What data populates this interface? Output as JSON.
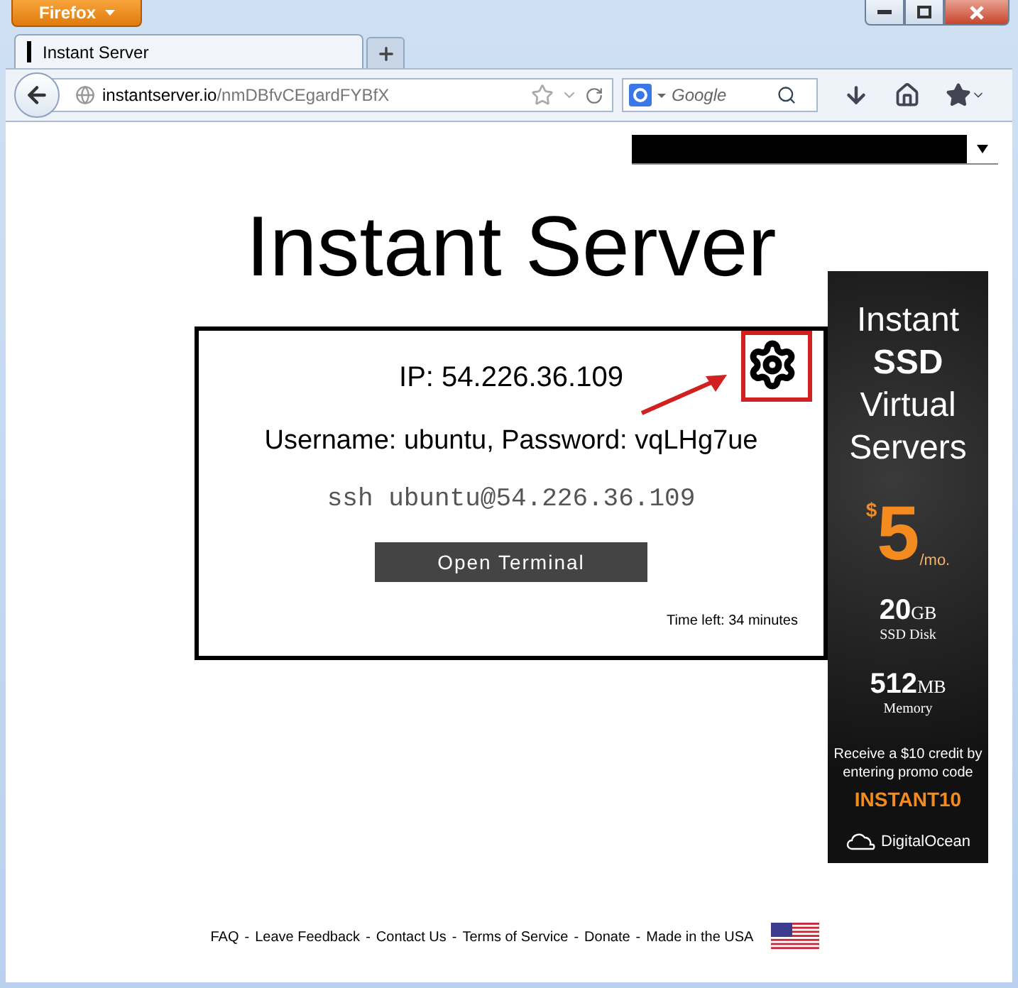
{
  "browser": {
    "app_menu": "Firefox",
    "tabs": [
      {
        "title": "Instant Server",
        "selected": true
      }
    ],
    "url": {
      "host": "instantserver.io",
      "path": "/nmDBfvCEgardFYBfX"
    },
    "search": {
      "placeholder": "Google"
    }
  },
  "page": {
    "title": "Instant Server",
    "server": {
      "ip": "IP: 54.226.36.109",
      "credentials": "Username: ubuntu, Password: vqLHg7ue",
      "ssh": "ssh ubuntu@54.226.36.109",
      "button": "Open Terminal",
      "time_left": "Time left: 34 minutes"
    },
    "ad": {
      "headline": [
        "Instant",
        "SSD",
        "Virtual",
        "Servers"
      ],
      "currency": "$",
      "price": "5",
      "period": "/mo.",
      "disk_amount": "20",
      "disk_unit": "GB",
      "disk_label": "SSD Disk",
      "memory_amount": "512",
      "memory_unit": "MB",
      "memory_label": "Memory",
      "offer": "Receive a $10 credit by entering promo code",
      "promo_code": "INSTANT10",
      "brand": "DigitalOcean"
    },
    "footer": {
      "separator": "-",
      "links": [
        "FAQ",
        "Leave Feedback",
        "Contact Us",
        "Terms of Service",
        "Donate",
        "Made in the USA"
      ]
    }
  }
}
